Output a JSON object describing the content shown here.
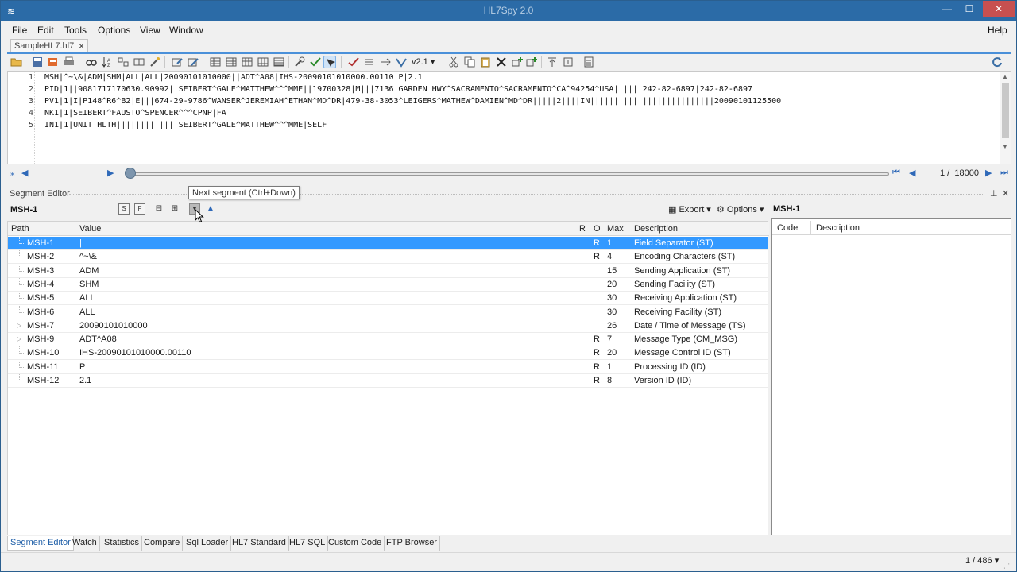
{
  "window": {
    "title": "HL7Spy 2.0",
    "minimize_glyph": "—",
    "maximize_glyph": "☐",
    "close_glyph": "✕"
  },
  "menu": [
    "File",
    "Edit",
    "Tools",
    "Options",
    "View",
    "Window",
    "Help"
  ],
  "doc_tab": {
    "label": "SampleHL7.hl7",
    "close": "×"
  },
  "toolbar": {
    "version": "v2.1"
  },
  "editor": {
    "lines": [
      {
        "num": "1",
        "text": "MSH|^~\\&|ADM|SHM|ALL|ALL|20090101010000||ADT^A08|IHS-20090101010000.00110|P|2.1"
      },
      {
        "num": "2",
        "text": "PID|1||9081717170630.90992||SEIBERT^GALE^MATTHEW^^^MME||19700328|M|||7136 GARDEN HWY^SACRAMENTO^SACRAMENTO^CA^94254^USA||||||242-82-6897|242-82-6897"
      },
      {
        "num": "3",
        "text": "PV1|1|I|P148^R6^B2|E|||674-29-9786^WANSER^JEREMIAH^ETHAN^MD^DR|479-38-3053^LEIGERS^MATHEW^DAMIEN^MD^DR|||||2||||IN||||||||||||||||||||||||||20090101125500"
      },
      {
        "num": "4",
        "text": "NK1|1|SEIBERT^FAUSTO^SPENCER^^^CPNP|FA"
      },
      {
        "num": "5",
        "text": "IN1|1|UNIT HLTH|||||||||||||SEIBERT^GALE^MATTHEW^^^MME|SELF"
      }
    ]
  },
  "navigation": {
    "position": "1",
    "total": "18000",
    "slider_fraction": 0.0
  },
  "segment_editor": {
    "title": "Segment Editor",
    "current": "MSH-1",
    "tooltip": "Next segment (Ctrl+Down)",
    "export_label": "Export",
    "options_label": "Options",
    "side_title": "MSH-1",
    "columns": {
      "path": "Path",
      "value": "Value",
      "r": "R",
      "o": "O",
      "max": "Max",
      "description": "Description"
    },
    "side_columns": {
      "code": "Code",
      "description": "Description"
    },
    "rows": [
      {
        "path": "MSH-1",
        "value": "|",
        "r": "R",
        "max": "1",
        "description": "Field Separator (ST)",
        "selected": true,
        "expandable": false
      },
      {
        "path": "MSH-2",
        "value": "^~\\&",
        "r": "R",
        "max": "4",
        "description": "Encoding Characters (ST)",
        "selected": false,
        "expandable": false
      },
      {
        "path": "MSH-3",
        "value": "ADM",
        "r": "",
        "max": "15",
        "description": "Sending Application (ST)",
        "selected": false,
        "expandable": false
      },
      {
        "path": "MSH-4",
        "value": "SHM",
        "r": "",
        "max": "20",
        "description": "Sending Facility (ST)",
        "selected": false,
        "expandable": false
      },
      {
        "path": "MSH-5",
        "value": "ALL",
        "r": "",
        "max": "30",
        "description": "Receiving Application (ST)",
        "selected": false,
        "expandable": false
      },
      {
        "path": "MSH-6",
        "value": "ALL",
        "r": "",
        "max": "30",
        "description": "Receiving Facility (ST)",
        "selected": false,
        "expandable": false
      },
      {
        "path": "MSH-7",
        "value": "20090101010000",
        "r": "",
        "max": "26",
        "description": "Date / Time of Message (TS)",
        "selected": false,
        "expandable": true
      },
      {
        "path": "MSH-9",
        "value": "ADT^A08",
        "r": "R",
        "max": "7",
        "description": "Message Type (CM_MSG)",
        "selected": false,
        "expandable": true
      },
      {
        "path": "MSH-10",
        "value": "IHS-20090101010000.00110",
        "r": "R",
        "max": "20",
        "description": "Message Control ID (ST)",
        "selected": false,
        "expandable": false
      },
      {
        "path": "MSH-11",
        "value": "P",
        "r": "R",
        "max": "1",
        "description": "Processing ID (ID)",
        "selected": false,
        "expandable": false
      },
      {
        "path": "MSH-12",
        "value": "2.1",
        "r": "R",
        "max": "8",
        "description": "Version ID (ID)",
        "selected": false,
        "expandable": false
      }
    ]
  },
  "bottom_tabs": [
    "Segment Editor",
    "Watch",
    "Statistics",
    "Compare",
    "Sql Loader",
    "HL7 Standard",
    "HL7 SQL",
    "Custom Code",
    "FTP Browser"
  ],
  "status": {
    "position": "1 / 486"
  },
  "colors": {
    "title_bar": "#2b6ba7",
    "selection": "#3399ff",
    "close": "#c75050",
    "link_blue": "#2f69b8"
  }
}
